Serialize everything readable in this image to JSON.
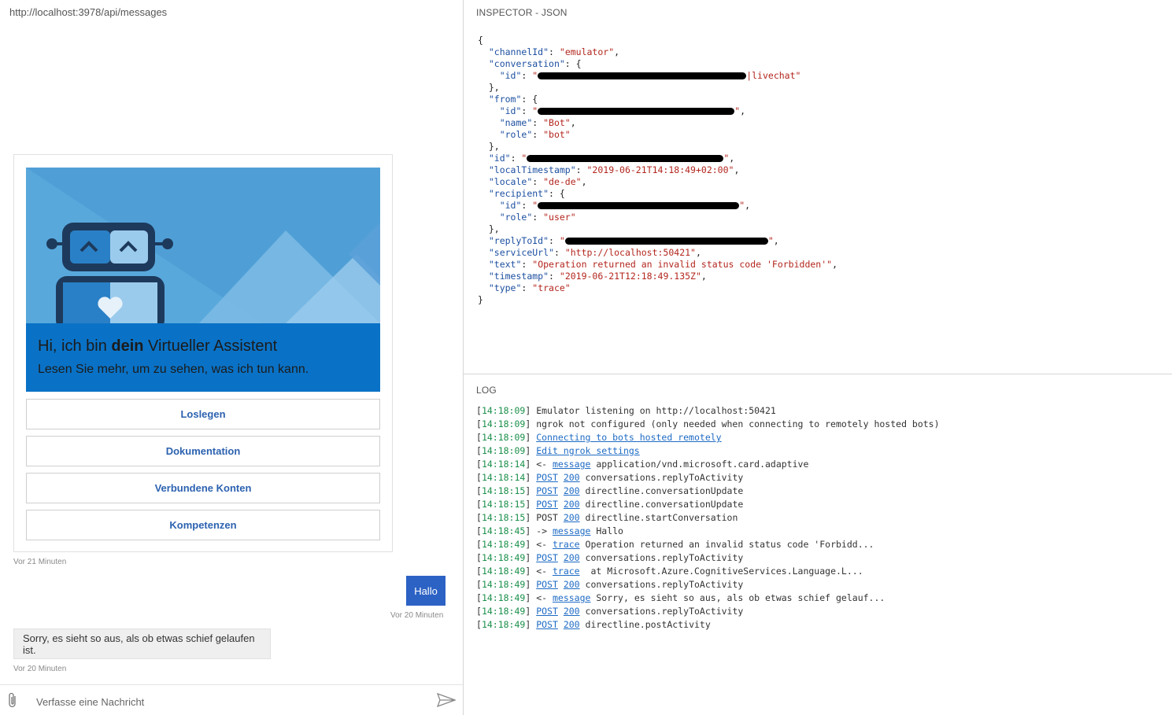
{
  "chat": {
    "endpoint": "http://localhost:3978/api/messages",
    "card": {
      "title_prefix": "Hi, ich bin ",
      "title_bold": "dein",
      "title_suffix": " Virtueller Assistent",
      "subtitle": "Lesen Sie mehr, um zu sehen, was ich tun kann.",
      "buttons": [
        "Loslegen",
        "Dokumentation",
        "Verbundene Konten",
        "Kompetenzen"
      ],
      "timestamp": "Vor 21 Minuten"
    },
    "user_message": {
      "text": "Hallo",
      "timestamp": "Vor 20 Minuten"
    },
    "bot_message": {
      "text": "Sorry, es sieht so aus, als ob etwas schief gelaufen ist.",
      "timestamp": "Vor 20 Minuten"
    },
    "composer": {
      "placeholder": "Verfasse eine Nachricht"
    }
  },
  "inspector": {
    "title": "INSPECTOR - JSON",
    "json": {
      "channelId": "\"emulator\"",
      "conversation_id_tail": "|livechat\"",
      "name": "\"Bot\"",
      "role_bot": "\"bot\"",
      "localTimestamp": "\"2019-06-21T14:18:49+02:00\"",
      "locale": "\"de-de\"",
      "role_user": "\"user\"",
      "serviceUrl": "\"http://localhost:50421\"",
      "text": "\"Operation returned an invalid status code 'Forbidden'\"",
      "timestamp": "\"2019-06-21T12:18:49.135Z\"",
      "type": "\"trace\""
    }
  },
  "log": {
    "title": "LOG",
    "entries": [
      {
        "time": "14:18:09",
        "parts": [
          {
            "t": "Emulator listening on http://localhost:50421",
            "link": false
          }
        ]
      },
      {
        "time": "14:18:09",
        "parts": [
          {
            "t": "ngrok not configured (only needed when connecting to remotely hosted bots)",
            "link": false
          }
        ]
      },
      {
        "time": "14:18:09",
        "parts": [
          {
            "t": "Connecting to bots hosted remotely",
            "link": true
          }
        ]
      },
      {
        "time": "14:18:09",
        "parts": [
          {
            "t": "Edit ngrok settings",
            "link": true
          }
        ]
      },
      {
        "time": "14:18:14",
        "parts": [
          {
            "t": "<- ",
            "link": false
          },
          {
            "t": "message",
            "link": true
          },
          {
            "t": " application/vnd.microsoft.card.adaptive",
            "link": false
          }
        ]
      },
      {
        "time": "14:18:14",
        "parts": [
          {
            "t": "POST",
            "link": true
          },
          {
            "t": " ",
            "link": false
          },
          {
            "t": "200",
            "link": true
          },
          {
            "t": " conversations.replyToActivity",
            "link": false
          }
        ]
      },
      {
        "time": "14:18:15",
        "parts": [
          {
            "t": "POST",
            "link": true
          },
          {
            "t": " ",
            "link": false
          },
          {
            "t": "200",
            "link": true
          },
          {
            "t": " directline.conversationUpdate",
            "link": false
          }
        ]
      },
      {
        "time": "14:18:15",
        "parts": [
          {
            "t": "POST",
            "link": true
          },
          {
            "t": " ",
            "link": false
          },
          {
            "t": "200",
            "link": true
          },
          {
            "t": " directline.conversationUpdate",
            "link": false
          }
        ]
      },
      {
        "time": "14:18:15",
        "parts": [
          {
            "t": "POST ",
            "link": false
          },
          {
            "t": "200",
            "link": true
          },
          {
            "t": " directline.startConversation",
            "link": false
          }
        ]
      },
      {
        "time": "14:18:45",
        "parts": [
          {
            "t": "-> ",
            "link": false
          },
          {
            "t": "message",
            "link": true
          },
          {
            "t": " Hallo",
            "link": false
          }
        ]
      },
      {
        "time": "14:18:49",
        "parts": [
          {
            "t": "<- ",
            "link": false
          },
          {
            "t": "trace",
            "link": true
          },
          {
            "t": " Operation returned an invalid status code 'Forbidd...",
            "link": false
          }
        ]
      },
      {
        "time": "14:18:49",
        "parts": [
          {
            "t": "POST",
            "link": true
          },
          {
            "t": " ",
            "link": false
          },
          {
            "t": "200",
            "link": true
          },
          {
            "t": " conversations.replyToActivity",
            "link": false
          }
        ]
      },
      {
        "time": "14:18:49",
        "parts": [
          {
            "t": "<- ",
            "link": false
          },
          {
            "t": "trace",
            "link": true
          },
          {
            "t": "  at Microsoft.Azure.CognitiveServices.Language.L...",
            "link": false
          }
        ]
      },
      {
        "time": "14:18:49",
        "parts": [
          {
            "t": "POST",
            "link": true
          },
          {
            "t": " ",
            "link": false
          },
          {
            "t": "200",
            "link": true
          },
          {
            "t": " conversations.replyToActivity",
            "link": false
          }
        ]
      },
      {
        "time": "14:18:49",
        "parts": [
          {
            "t": "<- ",
            "link": false
          },
          {
            "t": "message",
            "link": true
          },
          {
            "t": " Sorry, es sieht so aus, als ob etwas schief gelauf...",
            "link": false
          }
        ]
      },
      {
        "time": "14:18:49",
        "parts": [
          {
            "t": "POST",
            "link": true
          },
          {
            "t": " ",
            "link": false
          },
          {
            "t": "200",
            "link": true
          },
          {
            "t": " conversations.replyToActivity",
            "link": false
          }
        ]
      },
      {
        "time": "14:18:49",
        "parts": [
          {
            "t": "POST",
            "link": true
          },
          {
            "t": " ",
            "link": false
          },
          {
            "t": "200",
            "link": true
          },
          {
            "t": " directline.postActivity",
            "link": false
          }
        ]
      }
    ]
  }
}
